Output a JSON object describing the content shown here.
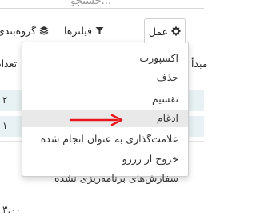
{
  "search": {
    "placeholder_fragment": "جستجو..."
  },
  "toolbar": {
    "group_by_label": "گروه‌بندی",
    "filters_label": "فیلترها",
    "action_label": "عمل"
  },
  "table": {
    "header_left_fragment": "تعداد",
    "header_right_fragment": "مبدأ",
    "row_values": [
      "۲",
      "۱"
    ]
  },
  "footer": {
    "total_fragment": "۳.۰۰"
  },
  "action_menu": {
    "items": [
      {
        "label": "اکسپورت"
      },
      {
        "label": "حذف"
      },
      {
        "label": "تقسیم"
      },
      {
        "label": "ادغام"
      },
      {
        "label": "علامت‌گذاری به عنوان انجام شده"
      },
      {
        "label": "خروج از رزرو"
      },
      {
        "label": "سفارش‌های برنامه‌ریزی نشده"
      }
    ],
    "highlighted_index": 3
  },
  "annotation": {
    "arrow_color": "#e8161b"
  },
  "colors": {
    "row_highlight": "#e8f1f3",
    "menu_hover": "#e9e9e9"
  }
}
